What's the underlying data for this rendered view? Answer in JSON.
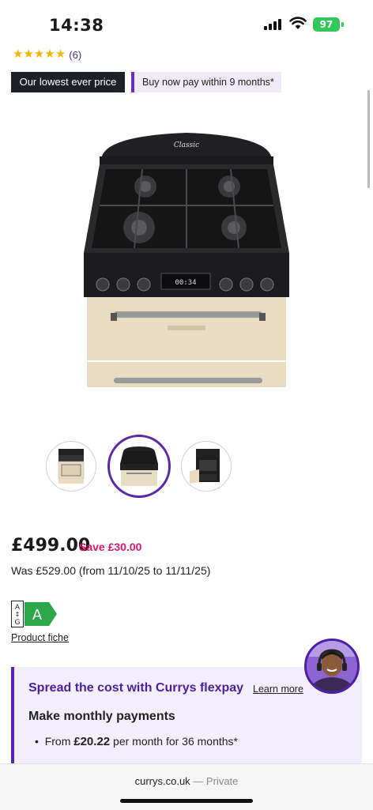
{
  "status": {
    "time": "14:38",
    "battery": "97"
  },
  "rating": {
    "count": "(6)",
    "stars": 5
  },
  "badges": {
    "lowest": "Our lowest ever price",
    "paylater": "Buy now pay within 9 months*"
  },
  "product": {
    "oven_display": "00:34",
    "price": "£499.00",
    "save": "Save £30.00",
    "was": "Was £529.00 (from 11/10/25 to 11/11/25)",
    "energy_class": "A",
    "energy_scale": "A↑G",
    "product_fiche": "Product fiche"
  },
  "flexpay": {
    "title": "Spread the cost with Currys flexpay",
    "learn_more": "Learn more",
    "subtitle": "Make monthly payments",
    "bullet_prefix": "From ",
    "bullet_amount": "£20.22",
    "bullet_suffix": " per month for 36 months*"
  },
  "browser": {
    "domain": "currys.co.uk",
    "mode": "— Private"
  },
  "colors": {
    "accent": "#5a22b0",
    "save": "#e0136d",
    "energy": "#2aa84a"
  }
}
